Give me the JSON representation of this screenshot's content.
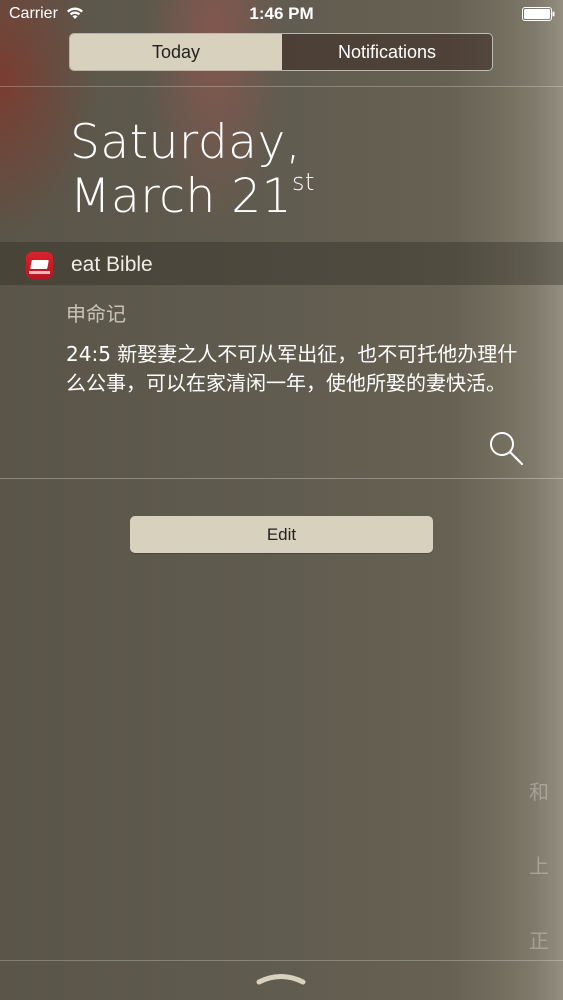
{
  "status_bar": {
    "carrier": "Carrier",
    "time": "1:46 PM"
  },
  "segmented_control": {
    "today_label": "Today",
    "notifications_label": "Notifications",
    "selected": "Today"
  },
  "date": {
    "line1": "Saturday,",
    "line2_main": "March 21",
    "line2_suffix": "st"
  },
  "widget": {
    "app_name": "eat Bible",
    "icon": "eat-bible-app-icon",
    "book": "申命记",
    "verse": "24:5 新娶妻之人不可从军出征，也不可托他办理什么公事，可以在家清闲一年，使他所娶的妻快活。",
    "search_icon": "search-icon"
  },
  "edit_label": "Edit",
  "background_glyphs": [
    "和",
    "上",
    "正"
  ],
  "colors": {
    "segment_active": "#d8d1bd",
    "background": "#5f5a4e",
    "app_icon_red": "#d8232c"
  }
}
